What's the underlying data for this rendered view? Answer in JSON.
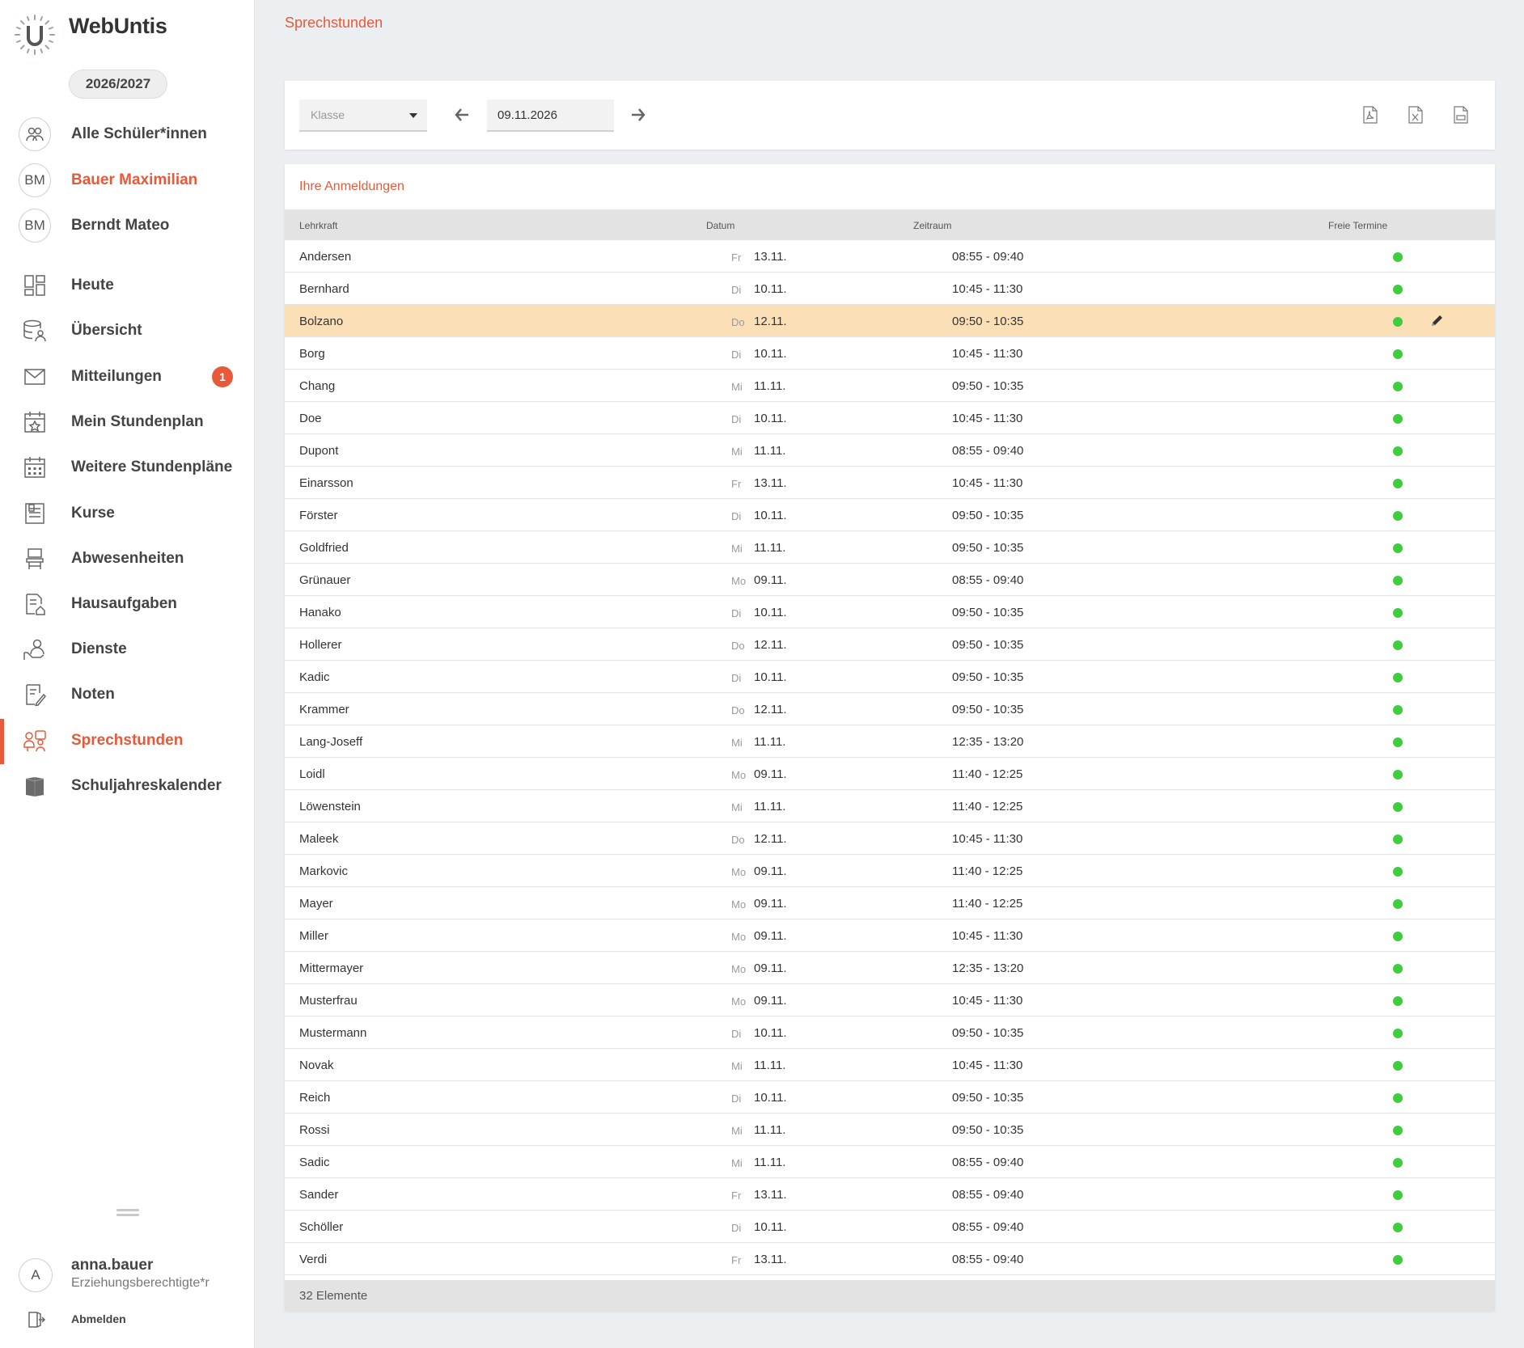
{
  "app": {
    "name": "WebUntis",
    "school_year": "2026/2027"
  },
  "sidebar": {
    "students": [
      {
        "label": "Alle Schüler*innen",
        "icon": "group-icon",
        "active": false
      },
      {
        "label": "Bauer Maximilian",
        "initials": "BM",
        "active": true
      },
      {
        "label": "Berndt Mateo",
        "initials": "BM",
        "active": false
      }
    ],
    "items": [
      {
        "label": "Heute",
        "icon": "dashboard-icon"
      },
      {
        "label": "Übersicht",
        "icon": "database-user-icon"
      },
      {
        "label": "Mitteilungen",
        "icon": "envelope-icon",
        "badge": "1"
      },
      {
        "label": "Mein Stundenplan",
        "icon": "calendar-star-icon"
      },
      {
        "label": "Weitere Stundenpläne",
        "icon": "calendar-grid-icon"
      },
      {
        "label": "Kurse",
        "icon": "course-list-icon"
      },
      {
        "label": "Abwesenheiten",
        "icon": "chair-icon"
      },
      {
        "label": "Hausaufgaben",
        "icon": "homework-icon"
      },
      {
        "label": "Dienste",
        "icon": "service-hand-icon"
      },
      {
        "label": "Noten",
        "icon": "grades-icon"
      },
      {
        "label": "Sprechstunden",
        "icon": "consultation-icon",
        "active": true
      },
      {
        "label": "Schuljahreskalender",
        "icon": "book-calendar-icon"
      }
    ],
    "user": {
      "initial": "A",
      "name": "anna.bauer",
      "role": "Erziehungsberechtigte*r"
    },
    "logout_label": "Abmelden"
  },
  "page": {
    "title": "Sprechstunden"
  },
  "toolbar": {
    "class_select_placeholder": "Klasse",
    "date_value": "09.11.2026",
    "exports": [
      "pdf-export-icon",
      "excel-export-icon",
      "csv-export-icon"
    ]
  },
  "registrations": {
    "title": "Ihre Anmeldungen",
    "columns": [
      "Lehrkraft",
      "Datum",
      "Zeitraum",
      "Freie Termine"
    ],
    "rows": [
      {
        "teacher": "Andersen",
        "day": "Fr",
        "date": "13.11.",
        "time": "08:55 - 09:40"
      },
      {
        "teacher": "Bernhard",
        "day": "Di",
        "date": "10.11.",
        "time": "10:45 - 11:30"
      },
      {
        "teacher": "Bolzano",
        "day": "Do",
        "date": "12.11.",
        "time": "09:50 - 10:35",
        "highlighted": true
      },
      {
        "teacher": "Borg",
        "day": "Di",
        "date": "10.11.",
        "time": "10:45 - 11:30"
      },
      {
        "teacher": "Chang",
        "day": "Mi",
        "date": "11.11.",
        "time": "09:50 - 10:35"
      },
      {
        "teacher": "Doe",
        "day": "Di",
        "date": "10.11.",
        "time": "10:45 - 11:30"
      },
      {
        "teacher": "Dupont",
        "day": "Mi",
        "date": "11.11.",
        "time": "08:55 - 09:40"
      },
      {
        "teacher": "Einarsson",
        "day": "Fr",
        "date": "13.11.",
        "time": "10:45 - 11:30"
      },
      {
        "teacher": "Förster",
        "day": "Di",
        "date": "10.11.",
        "time": "09:50 - 10:35"
      },
      {
        "teacher": "Goldfried",
        "day": "Mi",
        "date": "11.11.",
        "time": "09:50 - 10:35"
      },
      {
        "teacher": "Grünauer",
        "day": "Mo",
        "date": "09.11.",
        "time": "08:55 - 09:40"
      },
      {
        "teacher": "Hanako",
        "day": "Di",
        "date": "10.11.",
        "time": "09:50 - 10:35"
      },
      {
        "teacher": "Hollerer",
        "day": "Do",
        "date": "12.11.",
        "time": "09:50 - 10:35"
      },
      {
        "teacher": "Kadic",
        "day": "Di",
        "date": "10.11.",
        "time": "09:50 - 10:35"
      },
      {
        "teacher": "Krammer",
        "day": "Do",
        "date": "12.11.",
        "time": "09:50 - 10:35"
      },
      {
        "teacher": "Lang-Joseff",
        "day": "Mi",
        "date": "11.11.",
        "time": "12:35 - 13:20"
      },
      {
        "teacher": "Loidl",
        "day": "Mo",
        "date": "09.11.",
        "time": "11:40 - 12:25"
      },
      {
        "teacher": "Löwenstein",
        "day": "Mi",
        "date": "11.11.",
        "time": "11:40 - 12:25"
      },
      {
        "teacher": "Maleek",
        "day": "Do",
        "date": "12.11.",
        "time": "10:45 - 11:30"
      },
      {
        "teacher": "Markovic",
        "day": "Mo",
        "date": "09.11.",
        "time": "11:40 - 12:25"
      },
      {
        "teacher": "Mayer",
        "day": "Mo",
        "date": "09.11.",
        "time": "11:40 - 12:25"
      },
      {
        "teacher": "Miller",
        "day": "Mo",
        "date": "09.11.",
        "time": "10:45 - 11:30"
      },
      {
        "teacher": "Mittermayer",
        "day": "Mo",
        "date": "09.11.",
        "time": "12:35 - 13:20"
      },
      {
        "teacher": "Musterfrau",
        "day": "Mo",
        "date": "09.11.",
        "time": "10:45 - 11:30"
      },
      {
        "teacher": "Mustermann",
        "day": "Di",
        "date": "10.11.",
        "time": "09:50 - 10:35"
      },
      {
        "teacher": "Novak",
        "day": "Mi",
        "date": "11.11.",
        "time": "10:45 - 11:30"
      },
      {
        "teacher": "Reich",
        "day": "Di",
        "date": "10.11.",
        "time": "09:50 - 10:35"
      },
      {
        "teacher": "Rossi",
        "day": "Mi",
        "date": "11.11.",
        "time": "09:50 - 10:35"
      },
      {
        "teacher": "Sadic",
        "day": "Mi",
        "date": "11.11.",
        "time": "08:55 - 09:40"
      },
      {
        "teacher": "Sander",
        "day": "Fr",
        "date": "13.11.",
        "time": "08:55 - 09:40"
      },
      {
        "teacher": "Schöller",
        "day": "Di",
        "date": "10.11.",
        "time": "08:55 - 09:40"
      },
      {
        "teacher": "Verdi",
        "day": "Fr",
        "date": "13.11.",
        "time": "08:55 - 09:40"
      }
    ],
    "footer": "32 Elemente"
  },
  "colors": {
    "accent": "#e8593a",
    "highlight_row": "#fbe0b7",
    "free_dot": "#3fcd3f"
  }
}
